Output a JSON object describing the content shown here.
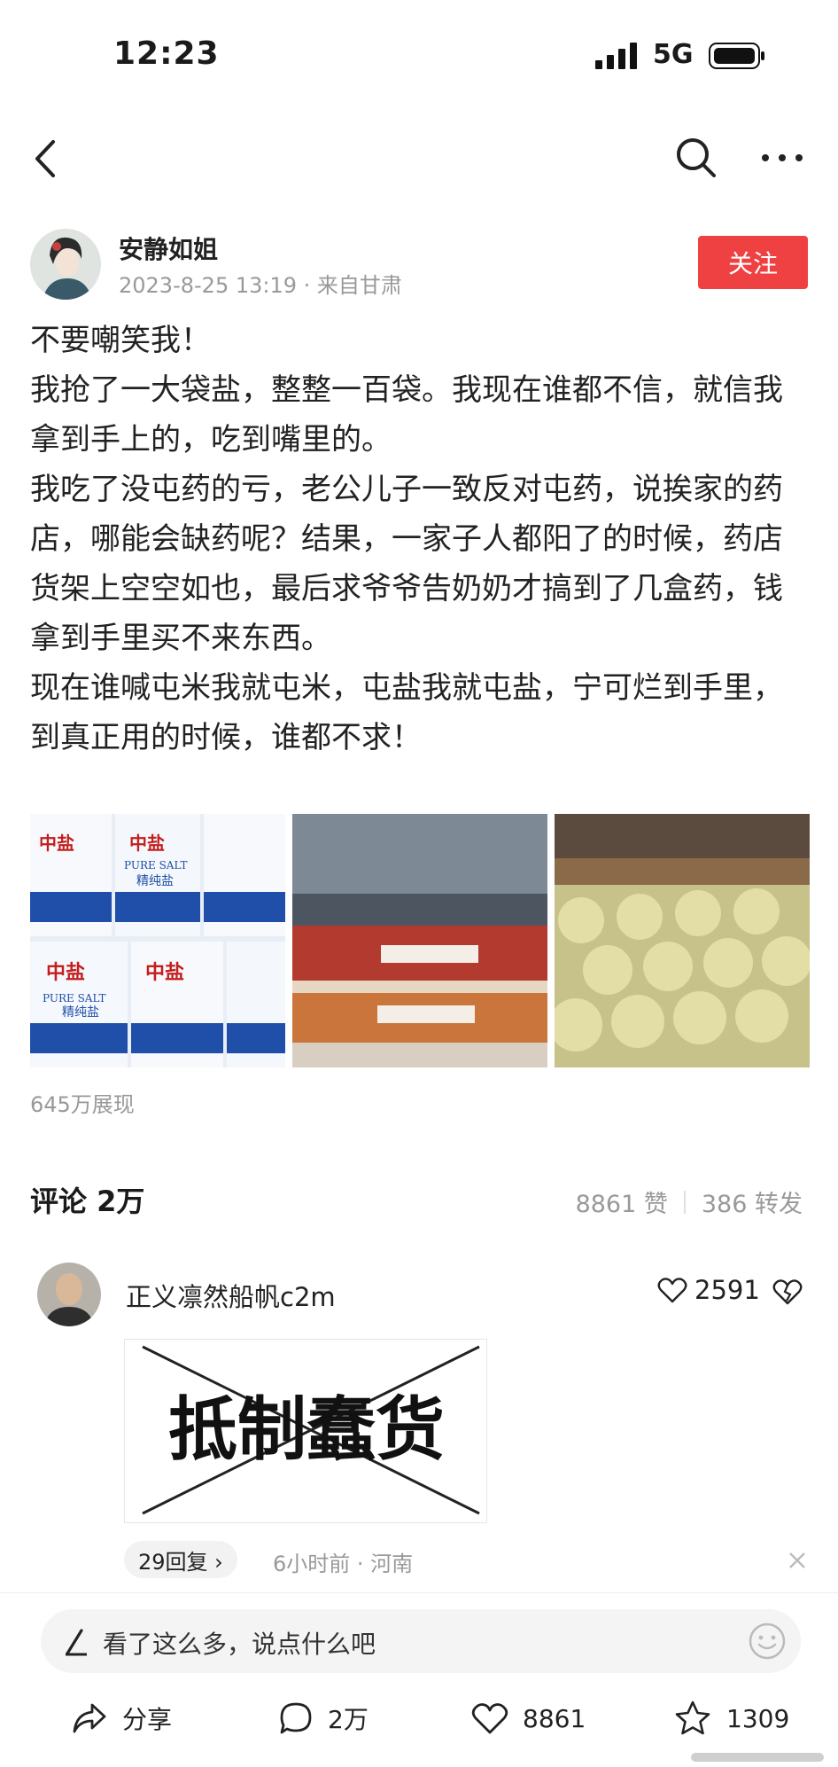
{
  "status_bar": {
    "time": "12:23",
    "network": "5G"
  },
  "author": {
    "name": "安静如姐",
    "meta": "2023-8-25 13:19 · 来自甘肃",
    "follow_label": "关注"
  },
  "post": {
    "paragraphs": [
      "不要嘲笑我！",
      "我抢了一大袋盐，整整一百袋。我现在谁都不信，就信我拿到手上的，吃到嘴里的。",
      "我吃了没屯药的亏，老公儿子一致反对屯药，说挨家的药店，哪能会缺药呢？结果，一家子人都阳了的时候，药店货架上空空如也，最后求爷爷告奶奶才搞到了几盒药，钱拿到手里买不来东西。",
      "现在谁喊屯米我就屯米，屯盐我就屯盐，宁可烂到手里，到真正用的时候，谁都不求！"
    ],
    "views": "645万展现",
    "image_texts": {
      "salt_brand": "中盐",
      "salt_en": "PURE SALT",
      "salt_cn": "精纯盐"
    }
  },
  "comments_section": {
    "title": "评论 2万",
    "likes": "8861 赞",
    "shares": "386 转发"
  },
  "comment": {
    "user": "正义凛然船帆c2m",
    "like_count": "2591",
    "image_text": "抵制蠢货",
    "reply_label": "29回复 ›",
    "time_location": "6小时前 · 河南"
  },
  "bottom": {
    "input_placeholder": "看了这么多，说点什么吧",
    "share_label": "分享",
    "comment_count": "2万",
    "like_count": "8861",
    "favorite_count": "1309"
  },
  "colors": {
    "follow": "#f04142",
    "muted": "#999999",
    "text": "#222222"
  }
}
